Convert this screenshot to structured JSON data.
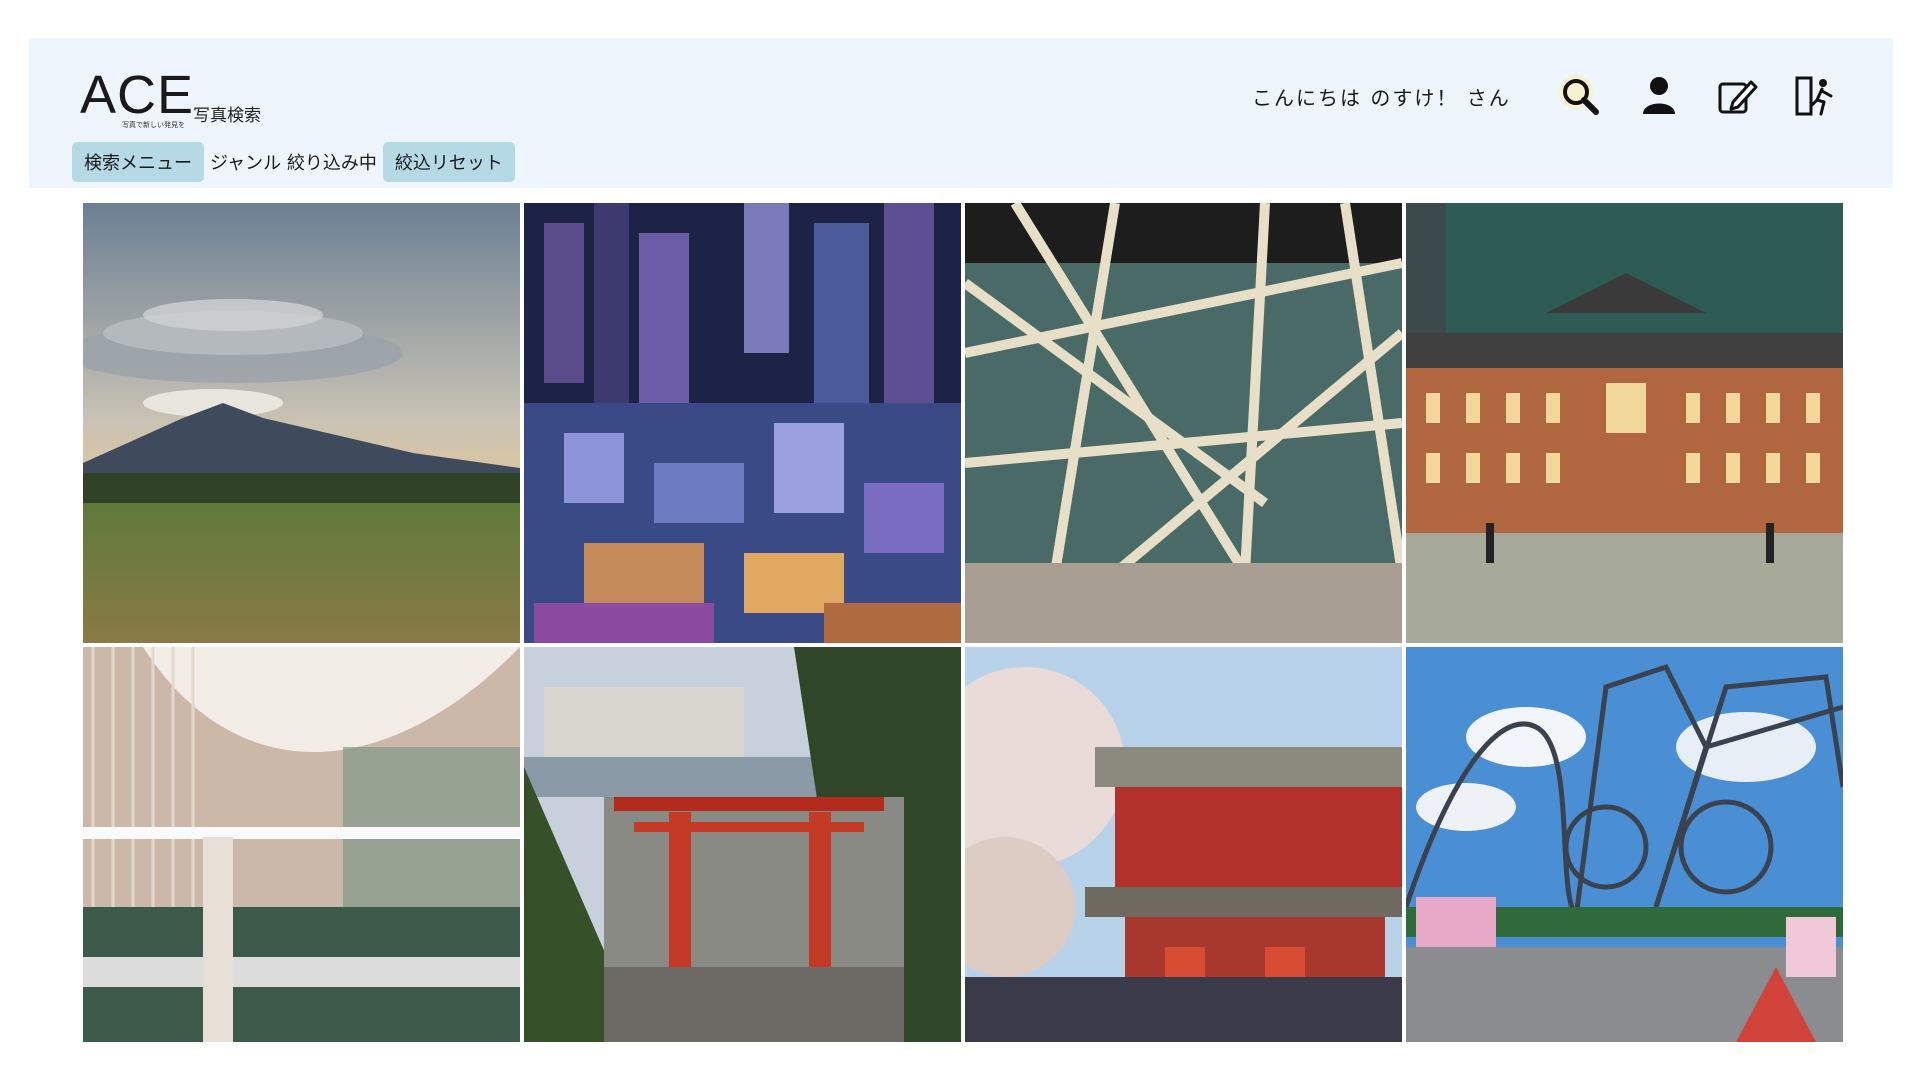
{
  "header": {
    "logo": "ACE",
    "logo_tagline": "写真で新しい発見を",
    "logo_subtitle": "写真検索",
    "greeting": "こんにちは のすけ！ さん",
    "icons": [
      "search-icon",
      "user-icon",
      "edit-icon",
      "logout-icon"
    ],
    "background_color": "#eef5fd"
  },
  "filter_bar": {
    "search_menu_label": "検索メニュー",
    "filter_status": "ジャンル 絞り込み中",
    "reset_label": "絞込リセット",
    "chip_color": "#b6d9e6"
  },
  "gallery": {
    "photos": [
      {
        "subject": "mountain-lenticular-cloud"
      },
      {
        "subject": "city-night-view"
      },
      {
        "subject": "glass-steel-atrium"
      },
      {
        "subject": "tokyo-station-night"
      },
      {
        "subject": "forum-atrium-interior"
      },
      {
        "subject": "shrine-torii-gate"
      },
      {
        "subject": "temple-gate-cherry-blossom"
      },
      {
        "subject": "roller-coaster-park"
      }
    ]
  }
}
